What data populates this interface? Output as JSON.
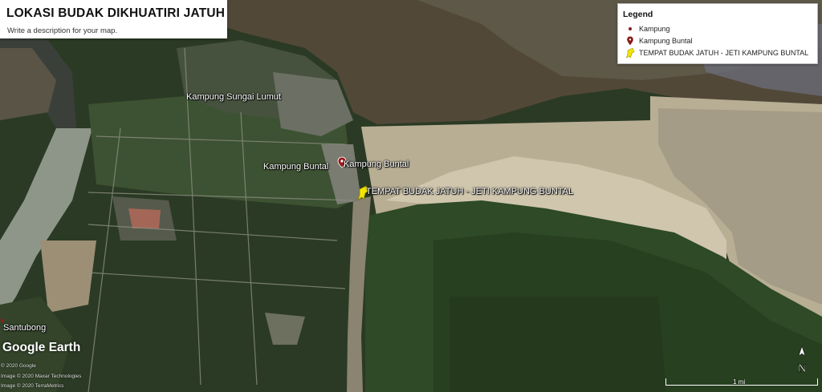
{
  "map": {
    "title": "LOKASI BUDAK DIKHUATIRI JATUH",
    "description": "Write a description for your map.",
    "labels": {
      "sungai_lumut": "Kampung Sungai Lumut",
      "buntal_1": "Kampung Buntal",
      "buntal_2": "Kampung Buntal",
      "tempat_jatuh": "TEMPAT BUDAK JATUH - JETI KAMPUNG BUNTAL",
      "santubong": "Santubong"
    }
  },
  "legend": {
    "heading": "Legend",
    "items": [
      {
        "label": "Kampung",
        "icon": "dot-icon",
        "color": "#8b1a1a"
      },
      {
        "label": "Kampung Buntal",
        "icon": "pin-icon",
        "color": "#8b1a1a"
      },
      {
        "label": "TEMPAT BUDAK JATUH - JETI KAMPUNG BUNTAL",
        "icon": "pushpin-icon",
        "color": "#f2e600"
      }
    ]
  },
  "branding": {
    "logo": "Google Earth",
    "attribution": [
      "© 2020 Google",
      "Image © 2020 Maxar Technologies",
      "Image © 2020 TerraMetrics"
    ]
  },
  "scale": {
    "label": "1 mi"
  },
  "compass": {
    "label": "N"
  }
}
